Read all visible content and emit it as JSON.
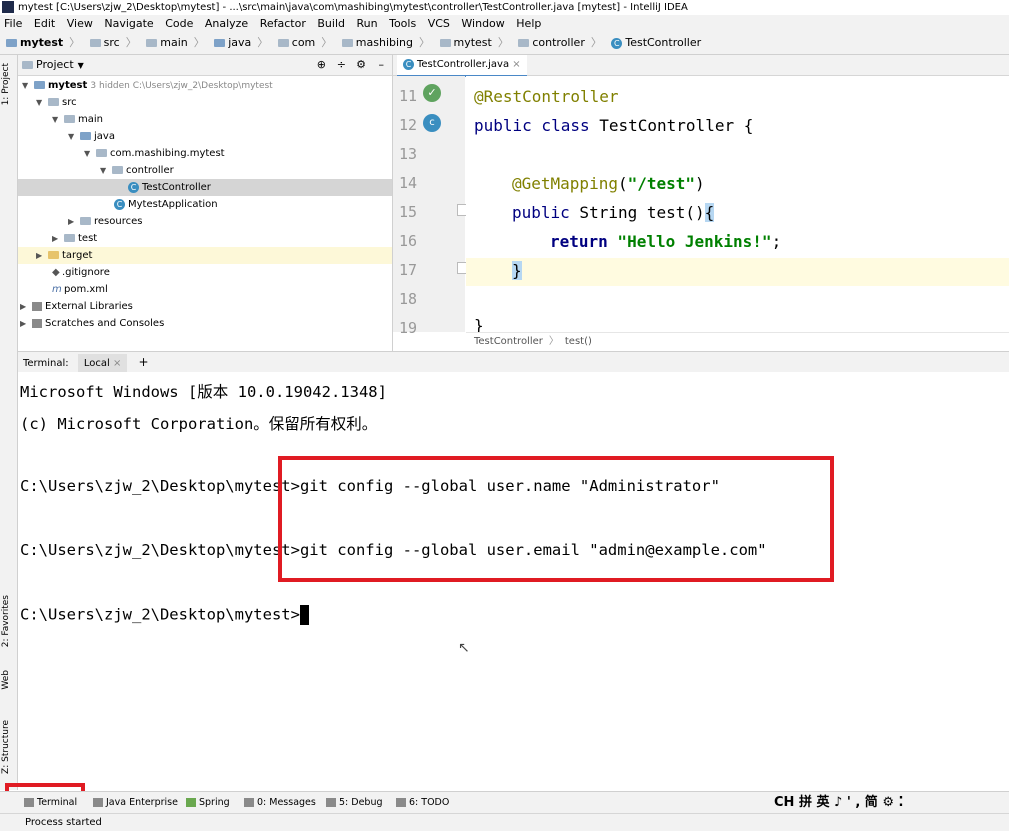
{
  "window": {
    "title": "mytest [C:\\Users\\zjw_2\\Desktop\\mytest] - ...\\src\\main\\java\\com\\mashibing\\mytest\\controller\\TestController.java [mytest] - IntelliJ IDEA"
  },
  "menu": [
    "File",
    "Edit",
    "View",
    "Navigate",
    "Code",
    "Analyze",
    "Refactor",
    "Build",
    "Run",
    "Tools",
    "VCS",
    "Window",
    "Help"
  ],
  "breadcrumb": [
    "mytest",
    "src",
    "main",
    "java",
    "com",
    "mashibing",
    "mytest",
    "controller",
    "TestController"
  ],
  "left_tool_tabs": {
    "project": "1: Project",
    "favorites": "2: Favorites",
    "web": "Web",
    "structure": "Z: Structure"
  },
  "project_panel": {
    "header": "Project",
    "tree": [
      {
        "label": "mytest",
        "note": "3 hidden  C:\\Users\\zjw_2\\Desktop\\mytest"
      },
      {
        "label": "src"
      },
      {
        "label": "main"
      },
      {
        "label": "java"
      },
      {
        "label": "com.mashibing.mytest"
      },
      {
        "label": "controller"
      },
      {
        "label": "TestController"
      },
      {
        "label": "MytestApplication"
      },
      {
        "label": "resources"
      },
      {
        "label": "test"
      },
      {
        "label": "target"
      },
      {
        "label": ".gitignore"
      },
      {
        "label": "pom.xml"
      },
      {
        "label": "External Libraries"
      },
      {
        "label": "Scratches and Consoles"
      }
    ]
  },
  "editor": {
    "tab": "TestController.java",
    "line_numbers": [
      "11",
      "12",
      "13",
      "14",
      "15",
      "16",
      "17",
      "18",
      "19"
    ],
    "code": {
      "l11": "@RestController",
      "l12_kw": "public class",
      "l12_rest": " TestController {",
      "l14_ann": "@GetMapping",
      "l14_paren": "(",
      "l14_str": "\"/test\"",
      "l14_close": ")",
      "l15_kw": "public",
      "l15_rest": " String test()",
      "l15_brace": "{",
      "l16_kw": "return",
      "l16_str": " \"Hello Jenkins!\"",
      "l16_end": ";",
      "l17": "}",
      "l19": "}"
    },
    "crumb": [
      "TestController",
      "test()"
    ]
  },
  "terminal": {
    "label": "Terminal:",
    "tab": "Local",
    "add": "+",
    "lines": {
      "l1": "Microsoft Windows [版本 10.0.19042.1348]",
      "l2": "(c) Microsoft Corporation。保留所有权利。",
      "prompt": "C:\\Users\\zjw_2\\Desktop\\mytest>",
      "cmd1": "git config --global user.name \"Administrator\"",
      "cmd2": "git config --global user.email \"admin@example.com\""
    }
  },
  "bottom_tools": [
    "Terminal",
    "Java Enterprise",
    "Spring",
    "0: Messages",
    "5: Debug",
    "6: TODO"
  ],
  "ime": "CH 拼 英 ♪ ' , 简 ⚙ ⁚",
  "status": "Process started",
  "colors": {
    "highlight_box": "#e01b23",
    "annotation": "#808000",
    "keyword": "#000080",
    "string": "#008000"
  }
}
